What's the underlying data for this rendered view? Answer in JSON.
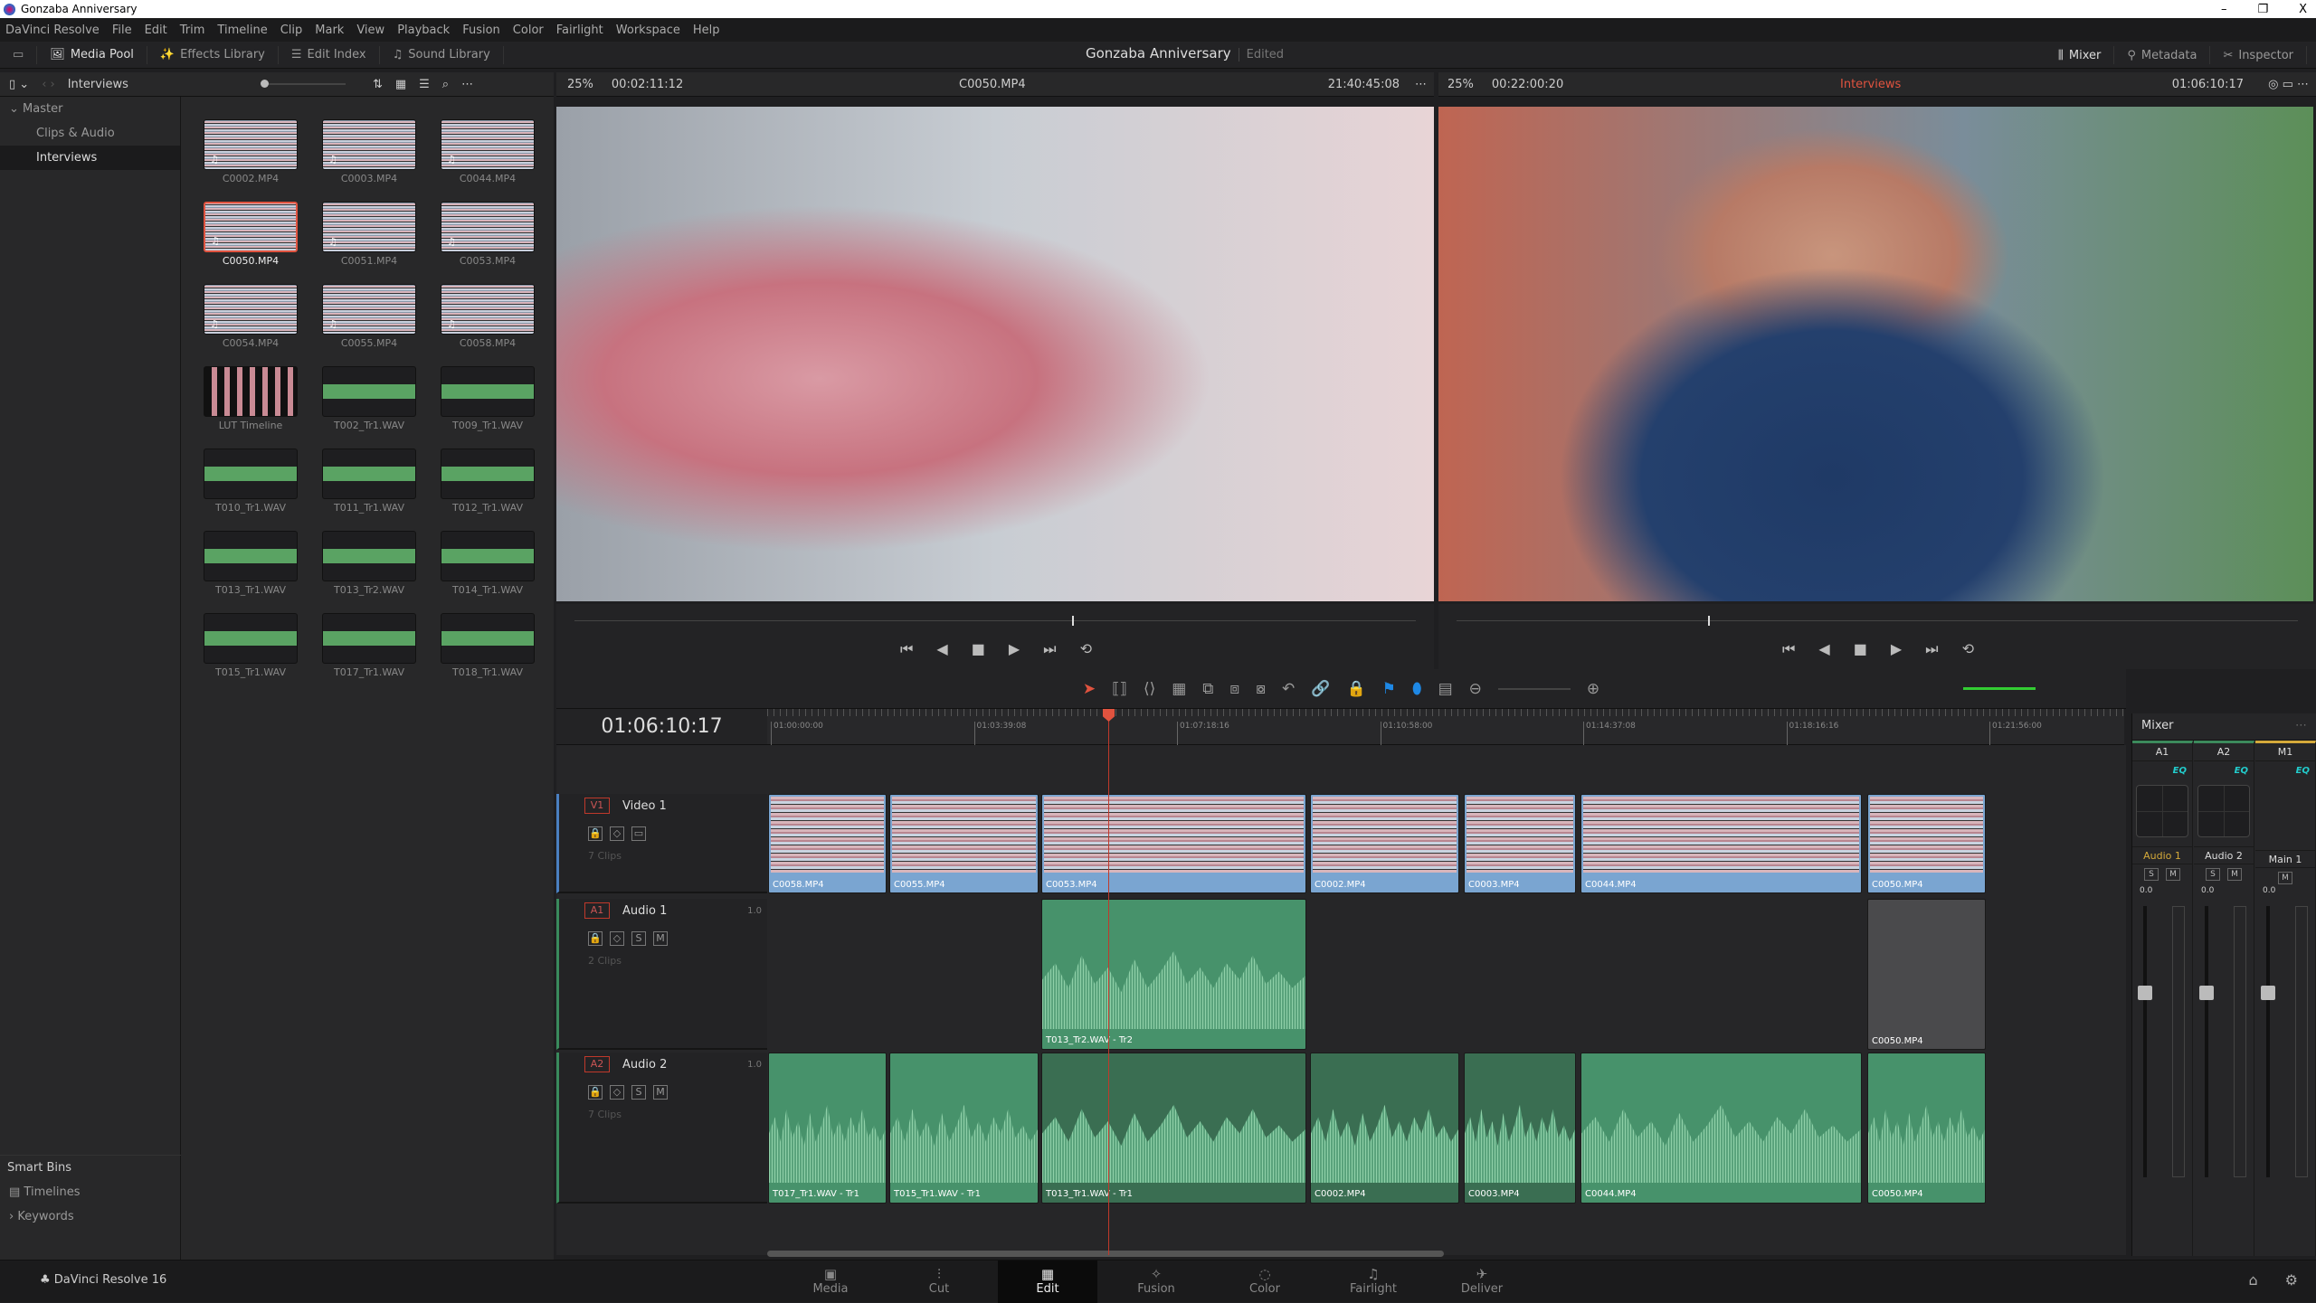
{
  "window": {
    "title": "Gonzaba Anniversary",
    "controls": [
      "–",
      "❐",
      "X"
    ]
  },
  "menu": [
    "DaVinci Resolve",
    "File",
    "Edit",
    "Trim",
    "Timeline",
    "Clip",
    "Mark",
    "View",
    "Playback",
    "Fusion",
    "Color",
    "Fairlight",
    "Workspace",
    "Help"
  ],
  "toolbar": {
    "left": [
      {
        "icon": "media-pool-icon",
        "label": "Media Pool",
        "active": true
      },
      {
        "icon": "effects-icon",
        "label": "Effects Library"
      },
      {
        "icon": "edit-index-icon",
        "label": "Edit Index"
      },
      {
        "icon": "sound-library-icon",
        "label": "Sound Library"
      }
    ],
    "project": "Gonzaba Anniversary",
    "status": "Edited",
    "right": [
      {
        "icon": "mixer-icon",
        "label": "Mixer",
        "active": true
      },
      {
        "icon": "metadata-icon",
        "label": "Metadata"
      },
      {
        "icon": "inspector-icon",
        "label": "Inspector"
      }
    ]
  },
  "pool": {
    "bin": "Interviews",
    "tree": {
      "master": "Master",
      "items": [
        "Clips & Audio",
        "Interviews"
      ],
      "selected": "Interviews"
    },
    "smart_bins": "Smart Bins",
    "smart_items": [
      "Timelines",
      "Keywords"
    ],
    "clips": [
      {
        "name": "C0002.MP4",
        "type": "video"
      },
      {
        "name": "C0003.MP4",
        "type": "video"
      },
      {
        "name": "C0044.MP4",
        "type": "video"
      },
      {
        "name": "C0050.MP4",
        "type": "video",
        "selected": true
      },
      {
        "name": "C0051.MP4",
        "type": "video"
      },
      {
        "name": "C0053.MP4",
        "type": "video"
      },
      {
        "name": "C0054.MP4",
        "type": "video"
      },
      {
        "name": "C0055.MP4",
        "type": "video"
      },
      {
        "name": "C0058.MP4",
        "type": "video"
      },
      {
        "name": "LUT Timeline",
        "type": "timeline"
      },
      {
        "name": "T002_Tr1.WAV",
        "type": "audio"
      },
      {
        "name": "T009_Tr1.WAV",
        "type": "audio"
      },
      {
        "name": "T010_Tr1.WAV",
        "type": "audio"
      },
      {
        "name": "T011_Tr1.WAV",
        "type": "audio"
      },
      {
        "name": "T012_Tr1.WAV",
        "type": "audio"
      },
      {
        "name": "T013_Tr1.WAV",
        "type": "audio"
      },
      {
        "name": "T013_Tr2.WAV",
        "type": "audio"
      },
      {
        "name": "T014_Tr1.WAV",
        "type": "audio"
      },
      {
        "name": "T015_Tr1.WAV",
        "type": "audio"
      },
      {
        "name": "T017_Tr1.WAV",
        "type": "audio"
      },
      {
        "name": "T018_Tr1.WAV",
        "type": "audio"
      }
    ]
  },
  "source": {
    "zoom": "25%",
    "duration": "00:02:11:12",
    "clip": "C0050.MP4",
    "timecode": "21:40:45:08"
  },
  "program": {
    "zoom": "25%",
    "duration": "00:22:00:20",
    "timeline": "Interviews",
    "timecode": "01:06:10:17"
  },
  "timeline": {
    "timecode": "01:06:10:17",
    "ruler": [
      "01:00:00:00",
      "01:03:39:08",
      "01:07:18:16",
      "01:10:58:00",
      "01:14:37:08",
      "01:18:16:16",
      "01:21:56:00"
    ],
    "tracks": [
      {
        "id": "V1",
        "name": "Video 1",
        "count": "7 Clips",
        "clips": [
          "C0058.MP4",
          "C0055.MP4",
          "C0053.MP4",
          "C0002.MP4",
          "C0003.MP4",
          "C0044.MP4",
          "C0050.MP4"
        ]
      },
      {
        "id": "A1",
        "name": "Audio 1",
        "level": "1.0",
        "count": "2 Clips",
        "clips": [
          "T013_Tr2.WAV - Tr2",
          "C0050.MP4"
        ]
      },
      {
        "id": "A2",
        "name": "Audio 2",
        "level": "1.0",
        "count": "7 Clips",
        "clips": [
          "T017_Tr1.WAV - Tr1",
          "T015_Tr1.WAV - Tr1",
          "T013_Tr1.WAV - Tr1",
          "C0002.MP4",
          "C0003.MP4",
          "C0044.MP4",
          "C0050.MP4"
        ]
      }
    ],
    "solo": "S",
    "mute": "M"
  },
  "mixer": {
    "title": "Mixer",
    "channels": [
      {
        "id": "A1",
        "name": "Audio 1",
        "level": "0.0",
        "color": "#d4a93a"
      },
      {
        "id": "A2",
        "name": "Audio 2",
        "level": "0.0"
      },
      {
        "id": "M1",
        "name": "Main 1",
        "level": "0.0"
      }
    ],
    "eq": "EQ"
  },
  "pages": {
    "app": "DaVinci Resolve 16",
    "items": [
      "Media",
      "Cut",
      "Edit",
      "Fusion",
      "Color",
      "Fairlight",
      "Deliver"
    ],
    "active": "Edit"
  },
  "colors": {
    "accent": "#e0533f",
    "video_clip": "#7aa5d1",
    "audio_clip": "#47926b",
    "eq": "#22cccc"
  }
}
